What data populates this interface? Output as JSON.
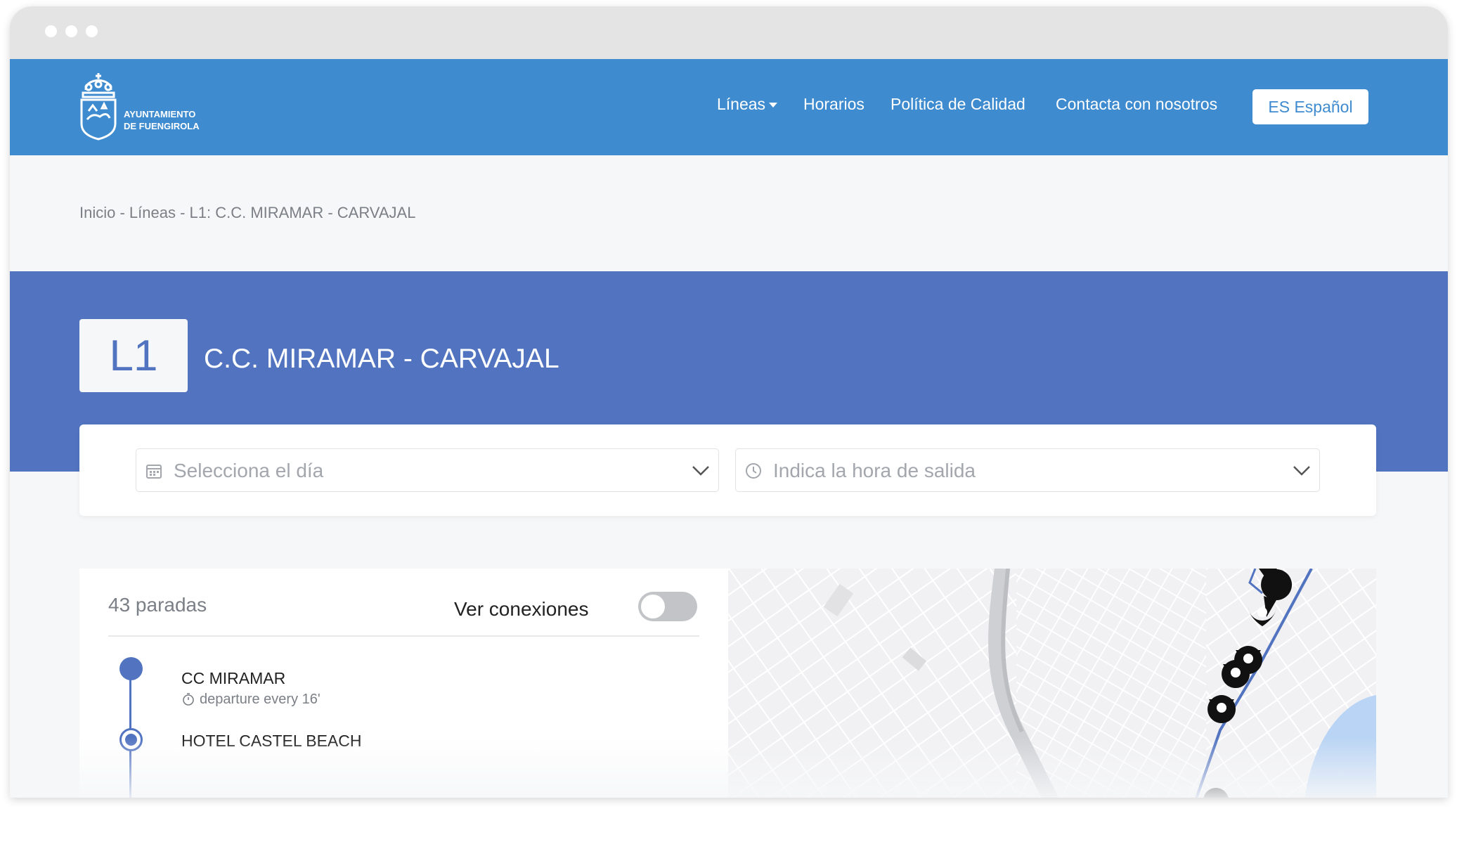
{
  "window": {
    "controls": [
      "close",
      "minimize",
      "maximize"
    ]
  },
  "header": {
    "logo_text_line1": "AYUNTAMIENTO",
    "logo_text_line2": "DE FUENGIROLA",
    "nav": {
      "lineas": "Líneas",
      "horarios": "Horarios",
      "calidad": "Política de Calidad",
      "contacto": "Contacta con nosotros"
    },
    "language_button": "ES Español"
  },
  "breadcrumb": "Inicio - Líneas - L1: C.C. MIRAMAR - CARVAJAL",
  "line": {
    "code": "L1",
    "title": "C.C. MIRAMAR - CARVAJAL",
    "color": "#5274c0"
  },
  "search": {
    "day_placeholder": "Selecciona el día",
    "time_placeholder": "Indica la hora de salida",
    "day_icon": "calendar-icon",
    "time_icon": "clock-icon"
  },
  "stops": {
    "count_label": "43 paradas",
    "connections_label": "Ver conexiones",
    "connections_enabled": false,
    "items": [
      {
        "name": "CC MIRAMAR",
        "frequency": "departure every 16'"
      },
      {
        "name": "HOTEL CASTEL BEACH"
      }
    ]
  },
  "map": {
    "route_color": "#5274c0",
    "marker_icon": "map-pin-icon"
  },
  "colors": {
    "header": "#3f8bcf",
    "hero": "#5274c0",
    "background": "#f6f7f9"
  }
}
